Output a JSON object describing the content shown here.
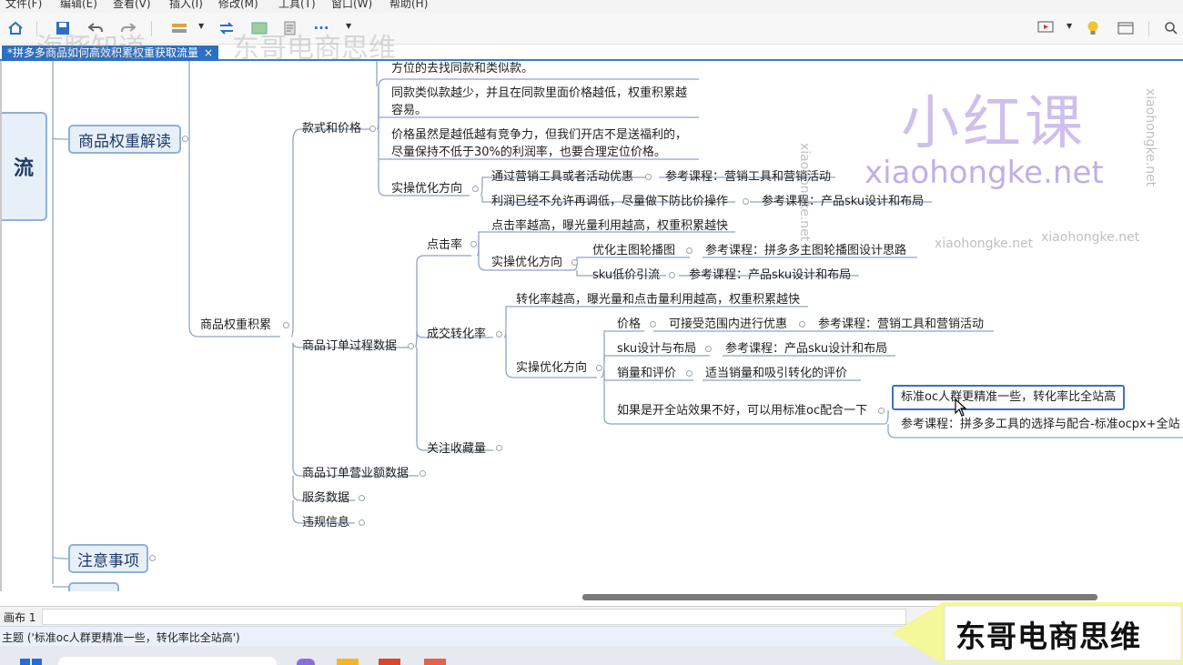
{
  "menu": [
    "文件(F)",
    "编辑(E)",
    "查看(V)",
    "插入(I)",
    "修改(M)",
    "工具(T)",
    "窗口(W)",
    "帮助(H)"
  ],
  "tab": {
    "title": "*拼多多商品如何高效积累权重获取流量",
    "close": "×"
  },
  "watermarks": {
    "faint_left": "海豚知道",
    "faint_right": "东哥电商思维",
    "site": "xiaohongke.net",
    "brand_cn": "小红课",
    "brand_en": "xiaohongke.net"
  },
  "colors": {
    "accent": "#2d6fc2",
    "topic_box": "#e7eff9",
    "topic_border": "#8fb0d9",
    "line": "#8ea5c4",
    "brand": "#b9a8e8",
    "banner": "#f4f79a"
  },
  "root": {
    "label": "流"
  },
  "level1": {
    "weight_intro": "商品权重解读",
    "notes": "注意事项"
  },
  "weight_accum": "商品权重积累",
  "style_price": {
    "label": "款式和价格",
    "line1": "方位的去找同款和类似款。",
    "line2a": "同款类似款越少，并且在同款里面价格越低，权重积累越",
    "line2b": "容易。",
    "line3a": "价格虽然是越低越有竞争力，但我们开店不是送福利的，",
    "line3b": "尽量保持不低于30%的利润率，也要合理定位价格。",
    "action": "实操优化方向",
    "a1": "通过营销工具或者活动优惠",
    "a1_ref": "参考课程：营销工具和营销活动",
    "a2": "利润已经不允许再调低，尽量做下防比价操作",
    "a2_ref": "参考课程：产品sku设计和布局"
  },
  "order_process": {
    "label": "商品订单过程数据",
    "ctr": {
      "label": "点击率",
      "desc": "点击率越高，曝光量利用越高，权重积累越快",
      "action": "实操优化方向",
      "a1": "优化主图轮播图",
      "a1_ref": "参考课程：拼多多主图轮播图设计思路",
      "a2": "sku低价引流",
      "a2_ref": "参考课程：产品sku设计和布局"
    },
    "cvr": {
      "label": "成交转化率",
      "desc": "转化率越高，曝光量和点击量利用越高，权重积累越快",
      "action": "实操优化方向",
      "price": "价格",
      "price_desc": "可接受范围内进行优惠",
      "price_ref": "参考课程：营销工具和营销活动",
      "sku": "sku设计与布局",
      "sku_ref": "参考课程：产品sku设计和布局",
      "sales": "销量和评价",
      "sales_desc": "适当销量和吸引转化的评价",
      "fallback": "如果是开全站效果不好，可以用标准oc配合一下",
      "selected": "标准oc人群更精准一些，转化率比全站高",
      "ref": "参考课程：拼多多工具的选择与配合-标准ocpx+全站"
    },
    "fav": "关注收藏量"
  },
  "revenue": "商品订单营业额数据",
  "service": "服务数据",
  "violation": "违规信息",
  "sheet_tab": "画布 1",
  "status": "主题 ('标准oc人群更精准一些，转化率比全站高')",
  "banner": "东哥电商思维"
}
